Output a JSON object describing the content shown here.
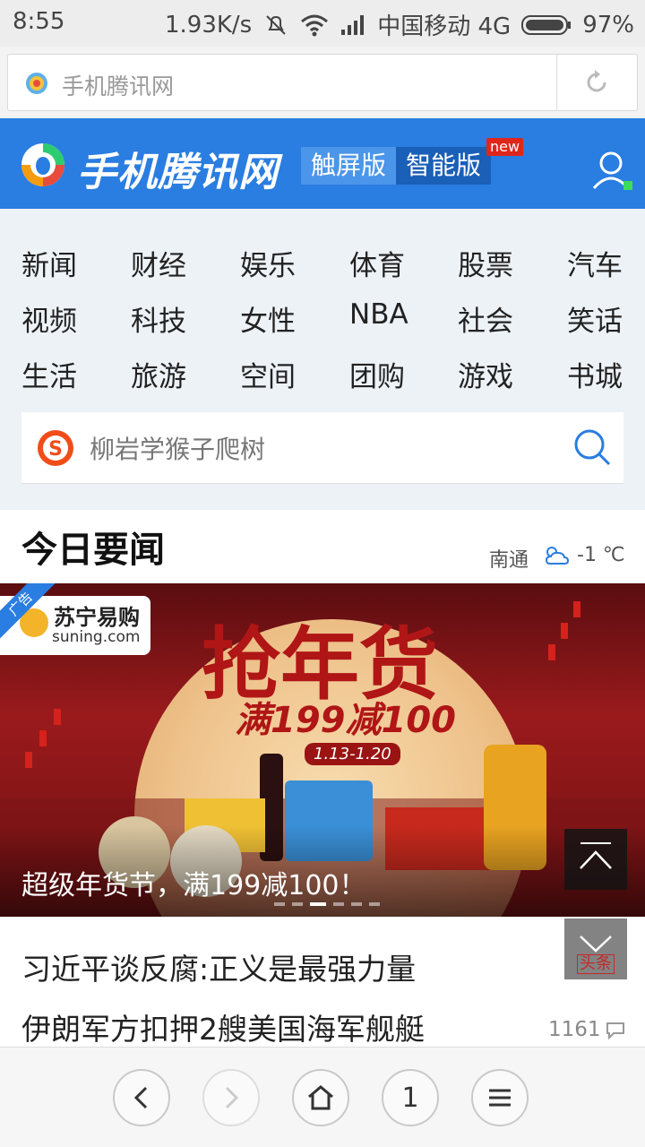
{
  "status_bar": {
    "time": "8:55",
    "speed": "1.93K/s",
    "carrier": "中国移动 4G",
    "battery": "97%"
  },
  "address_bar": {
    "url_text": "手机腾讯网"
  },
  "header": {
    "brand": "手机腾讯网",
    "tab_touch": "触屏版",
    "tab_smart": "智能版",
    "badge_new": "new",
    "accent_color": "#2a7de1"
  },
  "nav": {
    "items": [
      "新闻",
      "财经",
      "娱乐",
      "体育",
      "股票",
      "汽车",
      "视频",
      "科技",
      "女性",
      "NBA",
      "社会",
      "笑话",
      "生活",
      "旅游",
      "空间",
      "团购",
      "游戏",
      "书城"
    ]
  },
  "search": {
    "placeholder": "柳岩学猴子爬树"
  },
  "section": {
    "title": "今日要闻",
    "city": "南通",
    "temperature": "-1 ℃"
  },
  "banner": {
    "ad_label": "广告",
    "brand_cn": "苏宁易购",
    "brand_en": "suning.com",
    "headline": "抢年货",
    "promo": "满199减100",
    "dates": "1.13-1.20",
    "caption": "超级年货节，满199减100！",
    "slide_count": 6,
    "active_slide": 3
  },
  "floating": {
    "headline_tag": "头条"
  },
  "news": [
    {
      "title": "习近平谈反腐:正义是最强力量"
    },
    {
      "title": "伊朗军方扣押2艘美国海军舰艇",
      "comments": "1161"
    }
  ],
  "bottom_bar": {
    "page_count": "1"
  }
}
